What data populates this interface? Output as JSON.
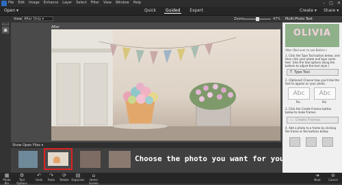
{
  "menu": {
    "items": [
      "File",
      "Edit",
      "Image",
      "Enhance",
      "Layer",
      "Select",
      "Filter",
      "View",
      "Window",
      "Help"
    ],
    "window_controls": [
      "–",
      "□",
      "✕"
    ]
  },
  "modebar": {
    "open_label": "Open",
    "tabs": [
      "Quick",
      "Guided",
      "Expert"
    ],
    "active_tab": "Guided",
    "create_label": "Create",
    "share_label": "Share"
  },
  "options": {
    "view_label": "View:",
    "view_value": "After Only",
    "zoom_label": "Zoom:",
    "zoom_value": "47%",
    "zoom_fraction": 0.47
  },
  "canvas": {
    "title": "After"
  },
  "panel": {
    "header": "Multi-Photo Text",
    "preview_word": "OLIVIA",
    "after_note": "After (Roll over to see Before.)",
    "step1": "1. Click the Type Tool button below, and then click your photo and type some text. (Use the tool options along the bottom to adjust the text style.)",
    "type_tool_label": "Type Tool",
    "step2": "2. (Optional) Choose how you'd like the text to appear on your photo.",
    "style_labels": [
      "Pix",
      "Pal"
    ],
    "step3": "3. Click the Create Frames button below to make frames.",
    "create_frames_label": "Create Frames",
    "step4": "4. Add a photo to a frame by clicking the frame or the buttons below."
  },
  "filmstrip": {
    "selector_label": "Show Open Files",
    "instruction": "Choose the photo you want for your base."
  },
  "bottom": {
    "left": [
      {
        "label": "Photo Bin",
        "icon": "photo-bin-icon"
      },
      {
        "label": "Tool Options",
        "icon": "tool-options-icon"
      },
      {
        "label": "Undo",
        "icon": "undo-icon"
      },
      {
        "label": "Redo",
        "icon": "redo-icon"
      },
      {
        "label": "Rotate",
        "icon": "rotate-icon"
      },
      {
        "label": "Organizer",
        "icon": "organizer-icon"
      },
      {
        "label": "Home Screen",
        "icon": "home-icon"
      }
    ],
    "right": [
      {
        "label": "Next",
        "icon": "next-icon"
      },
      {
        "label": "Cancel",
        "icon": "cancel-icon"
      }
    ]
  },
  "colors": {
    "accent_blue": "#2c6cbf",
    "thumb_highlight": "#e02020"
  }
}
